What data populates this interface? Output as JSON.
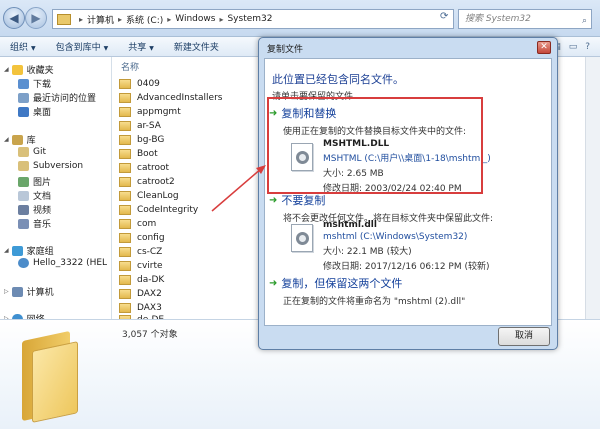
{
  "address": {
    "crumbs": [
      "计算机",
      "系统 (C:)",
      "Windows",
      "System32"
    ],
    "search_placeholder": "搜索 System32"
  },
  "toolbar": {
    "organize": "组织",
    "include": "包含到库中",
    "share": "共享",
    "new_folder": "新建文件夹"
  },
  "nav": {
    "favorites": "收藏夹",
    "downloads": "下载",
    "recent": "最近访问的位置",
    "desktop": "桌面",
    "libraries": "库",
    "git": "Git",
    "subversion": "Subversion",
    "pictures": "图片",
    "documents": "文档",
    "videos": "视频",
    "music": "音乐",
    "homegroup": "家庭组",
    "user": "Hello_3322 (HEL",
    "computer": "计算机",
    "network": "网络"
  },
  "files": {
    "header": "名称",
    "items": [
      "0409",
      "AdvancedInstallers",
      "appmgmt",
      "ar-SA",
      "bg-BG",
      "Boot",
      "catroot",
      "catroot2",
      "CleanLog",
      "CodeIntegrity",
      "com",
      "config",
      "cs-CZ",
      "cvirte",
      "da-DK",
      "DAX2",
      "DAX3",
      "de-DE"
    ]
  },
  "details": {
    "count": "3,057 个对象"
  },
  "dialog": {
    "title": "复制文件",
    "heading": "此位置已经包含同名文件。",
    "sub": "请单击要保留的文件",
    "replace": {
      "title": "复制和替换",
      "desc": "使用正在复制的文件替换目标文件夹中的文件:",
      "name": "MSHTML.DLL",
      "path": "MSHTML (C:\\用户\\\\桌面\\1-18\\mshtml_)",
      "size": "大小: 2.65 MB",
      "date": "修改日期: 2003/02/24 02:40 PM"
    },
    "skip": {
      "title": "不要复制",
      "desc": "将不会更改任何文件。将在目标文件夹中保留此文件:",
      "name": "mshtml.dll",
      "path": "mshtml (C:\\Windows\\System32)",
      "size": "大小: 22.1 MB (较大)",
      "date": "修改日期: 2017/12/16 06:12 PM (较新)"
    },
    "keep_both": {
      "title": "复制，但保留这两个文件",
      "desc": "正在复制的文件将重命名为 \"mshtml (2).dll\""
    },
    "cancel": "取消"
  }
}
